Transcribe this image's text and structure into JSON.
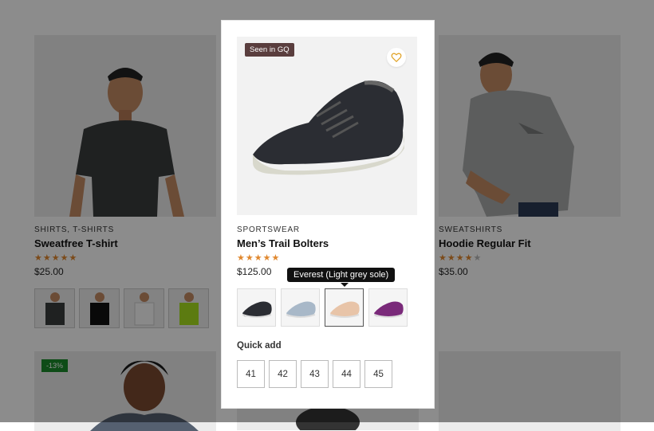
{
  "products": [
    {
      "category": "SHIRTS",
      "category2": "T-SHIRTS",
      "title": "Sweatfree T-shirt",
      "rating": 5,
      "price": "$25.00",
      "thumbs": [
        "charcoal-shirt",
        "black-shirt",
        "white-shirt",
        "lime-shirt"
      ]
    },
    {
      "category": "SPORTSWEAR",
      "title": "Men’s Trail Bolters",
      "rating": 5,
      "price": "$125.00",
      "badge": "Seen in GQ",
      "tooltip": "Everest (Light grey sole)",
      "quick_add_label": "Quick add",
      "sizes": [
        "41",
        "42",
        "43",
        "44",
        "45"
      ]
    },
    {
      "category": "SWEATSHIRTS",
      "title": "Hoodie Regular Fit",
      "rating": 4,
      "price": "$35.00"
    }
  ],
  "second_row": {
    "discount_badge": "-13%"
  },
  "colors": {
    "star": "#e0882f",
    "badge_seen_bg": "#5a3e3e",
    "discount_bg": "#1a8a2a",
    "overlay": "rgba(0,0,0,0.45)"
  }
}
